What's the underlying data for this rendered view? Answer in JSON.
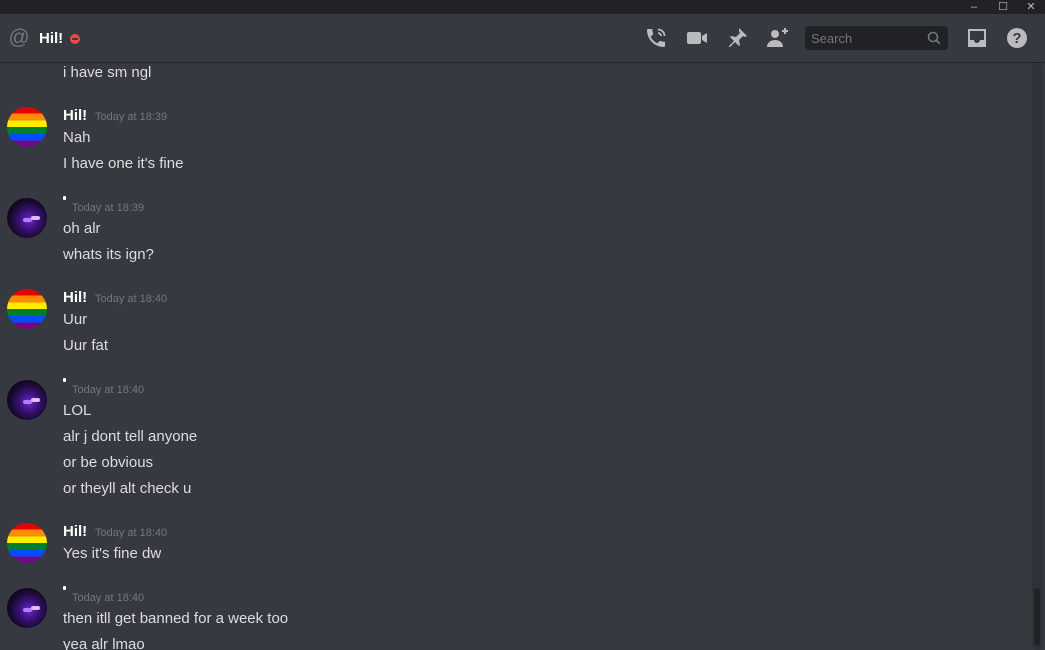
{
  "window_controls": {
    "minimize": "–",
    "maximize": "☐",
    "close": "✕"
  },
  "header": {
    "channel_name": "Hil!",
    "status": "do-not-disturb",
    "status_color": "#f04747",
    "search_placeholder": "Search",
    "icons": [
      "start-voice-call-icon",
      "start-video-call-icon",
      "pinned-messages-icon",
      "add-friend-icon",
      "inbox-icon",
      "help-icon"
    ]
  },
  "messages": [
    {
      "continued": true,
      "lines": [
        "i have sm ngl"
      ]
    },
    {
      "author": "Hil!",
      "avatar": "rainbow",
      "timestamp": "Today at 18:39",
      "lines": [
        "Nah",
        "I have one it's fine"
      ]
    },
    {
      "author": "",
      "avatar": "dark-purple",
      "timestamp": "Today at 18:39",
      "lines": [
        "oh alr",
        "whats its ign?"
      ]
    },
    {
      "author": "Hil!",
      "avatar": "rainbow",
      "timestamp": "Today at 18:40",
      "lines": [
        "Uur",
        "Uur fat"
      ]
    },
    {
      "author": "",
      "avatar": "dark-purple",
      "timestamp": "Today at 18:40",
      "lines": [
        "LOL",
        "alr j dont tell anyone",
        "or be obvious",
        "or theyll alt check u"
      ]
    },
    {
      "author": "Hil!",
      "avatar": "rainbow",
      "timestamp": "Today at 18:40",
      "lines": [
        "Yes it's fine dw"
      ]
    },
    {
      "author": "",
      "avatar": "dark-purple",
      "timestamp": "Today at 18:40",
      "lines": [
        "then  itll get banned for a week too",
        "yea alr lmao"
      ]
    }
  ],
  "colors": {
    "background": "#36393f",
    "titlebar": "#202225",
    "text": "#dcddde",
    "muted": "#72767d"
  }
}
